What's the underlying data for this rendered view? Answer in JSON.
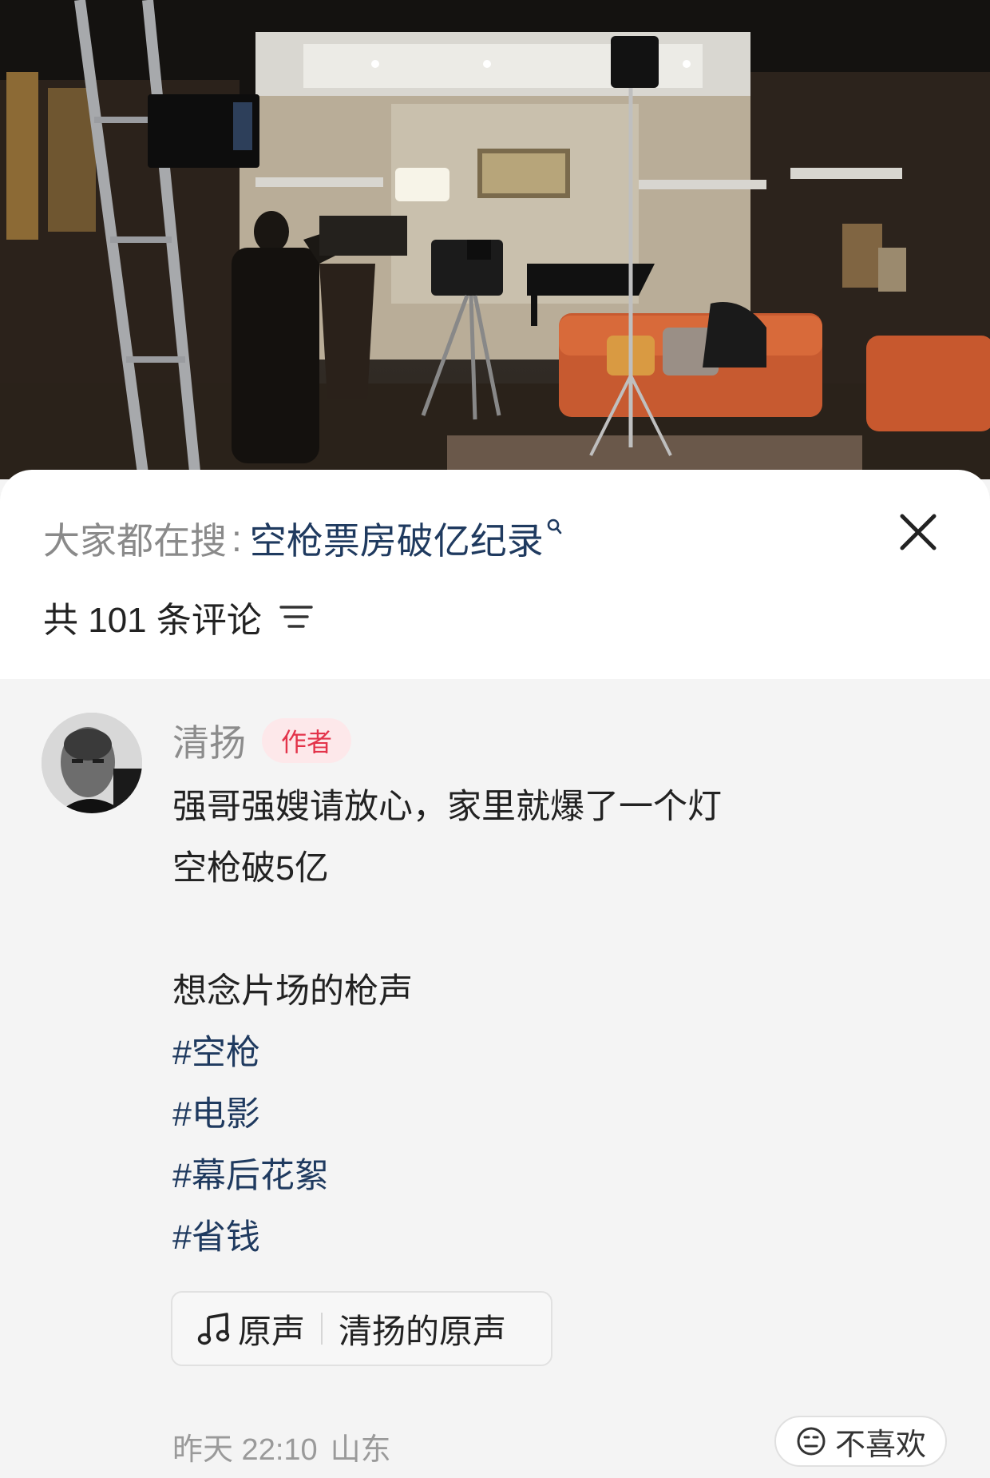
{
  "hot_search": {
    "prefix": "大家都在搜",
    "separator": ":",
    "term": "空枪票房破亿纪录"
  },
  "comments_header": {
    "count_text": "共 101 条评论"
  },
  "comment": {
    "author": "清扬",
    "badge": "作者",
    "lines": [
      "强哥强嫂请放心，家里就爆了一个灯",
      "空枪破5亿",
      "",
      "想念片场的枪声"
    ],
    "hashtags": [
      "#空枪",
      "#电影",
      "#幕后花絮",
      "#省钱"
    ],
    "music": {
      "label": "原声",
      "title": "清扬的原声"
    },
    "meta": {
      "time": "昨天 22:10",
      "location": "山东"
    },
    "dislike_label": "不喜欢"
  },
  "icons": {
    "close": "close-icon",
    "sort": "sort-icon",
    "search_mark": "search-icon",
    "music": "music-note-icon",
    "dislike": "frown-face-icon"
  },
  "colors": {
    "hashtag": "#1f3a5f",
    "badge_text": "#e3334a",
    "badge_bg": "#fde8ea",
    "muted_text": "#8c8c8c"
  }
}
